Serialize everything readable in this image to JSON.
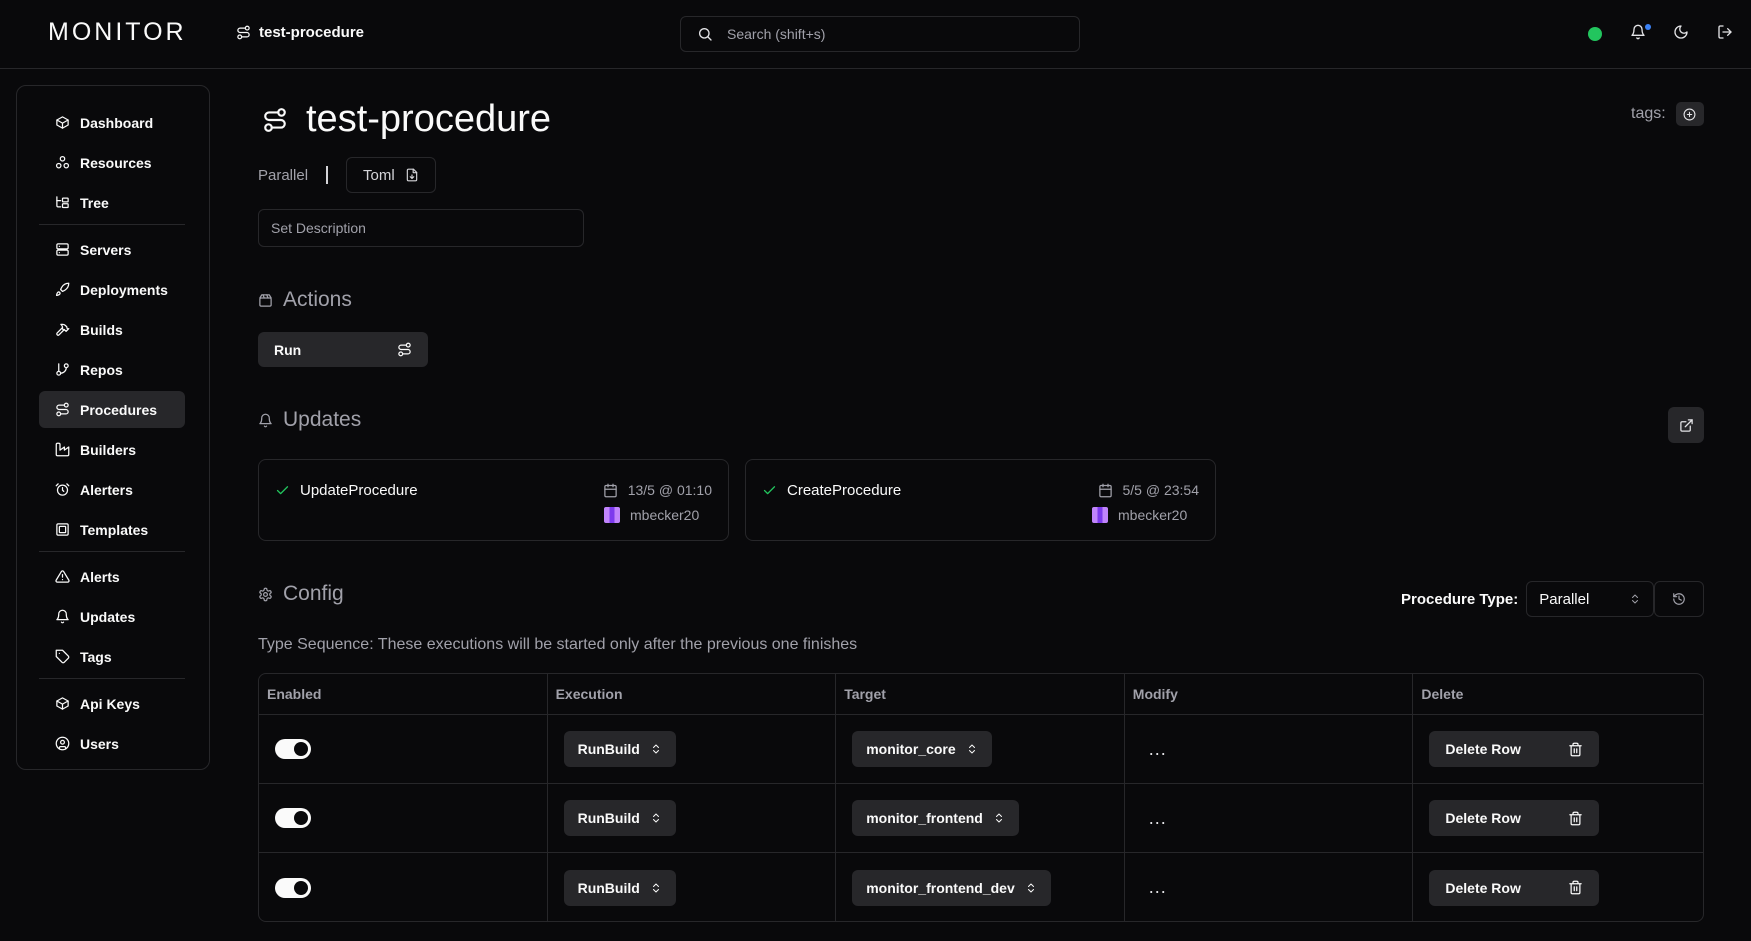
{
  "app": {
    "logo": "MONITOR"
  },
  "header": {
    "breadcrumb": "test-procedure",
    "search_placeholder": "Search (shift+s)"
  },
  "sidebar": {
    "items": [
      {
        "label": "Dashboard",
        "icon": "box-icon"
      },
      {
        "label": "Resources",
        "icon": "boxes-icon"
      },
      {
        "label": "Tree",
        "icon": "tree-icon"
      },
      {
        "label": "Servers",
        "icon": "server-icon"
      },
      {
        "label": "Deployments",
        "icon": "rocket-icon"
      },
      {
        "label": "Builds",
        "icon": "hammer-icon"
      },
      {
        "label": "Repos",
        "icon": "git-branch-icon"
      },
      {
        "label": "Procedures",
        "icon": "route-icon",
        "active": true
      },
      {
        "label": "Builders",
        "icon": "factory-icon"
      },
      {
        "label": "Alerters",
        "icon": "alarm-icon"
      },
      {
        "label": "Templates",
        "icon": "template-icon"
      },
      {
        "label": "Alerts",
        "icon": "alert-triangle-icon"
      },
      {
        "label": "Updates",
        "icon": "bell-icon"
      },
      {
        "label": "Tags",
        "icon": "tag-icon"
      },
      {
        "label": "Api Keys",
        "icon": "key-box-icon"
      },
      {
        "label": "Users",
        "icon": "user-circle-icon"
      }
    ]
  },
  "page": {
    "title": "test-procedure",
    "tags_label": "tags:",
    "type_label": "Parallel",
    "toml_label": "Toml",
    "description_placeholder": "Set Description"
  },
  "actions": {
    "heading": "Actions",
    "run_label": "Run"
  },
  "updates": {
    "heading": "Updates",
    "cards": [
      {
        "name": "UpdateProcedure",
        "date": "13/5 @ 01:10",
        "user": "mbecker20"
      },
      {
        "name": "CreateProcedure",
        "date": "5/5 @ 23:54",
        "user": "mbecker20"
      }
    ]
  },
  "config": {
    "heading": "Config",
    "procedure_type_label": "Procedure Type:",
    "procedure_type_value": "Parallel",
    "type_description": "Type Sequence: These executions will be started only after the previous one finishes",
    "columns": [
      "Enabled",
      "Execution",
      "Target",
      "Modify",
      "Delete"
    ],
    "rows": [
      {
        "enabled": true,
        "execution": "RunBuild",
        "target": "monitor_core",
        "modify": "...",
        "delete": "Delete Row"
      },
      {
        "enabled": true,
        "execution": "RunBuild",
        "target": "monitor_frontend",
        "modify": "...",
        "delete": "Delete Row"
      },
      {
        "enabled": true,
        "execution": "RunBuild",
        "target": "monitor_frontend_dev",
        "modify": "...",
        "delete": "Delete Row"
      }
    ]
  },
  "colors": {
    "background": "#09090b",
    "border": "#27272a",
    "status_ok": "#22c55e",
    "notification": "#3b82f6"
  }
}
